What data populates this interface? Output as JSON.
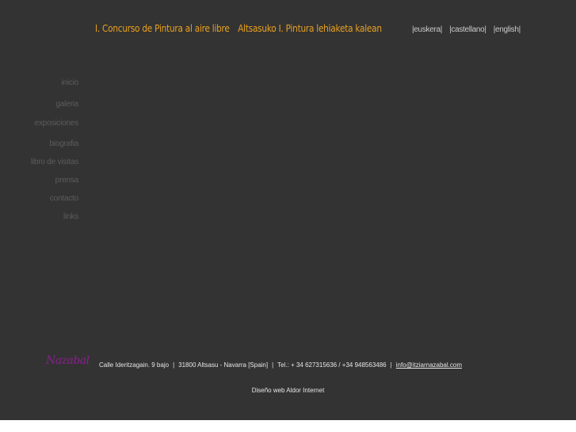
{
  "header": {
    "title_es": "I. Concurso de Pintura al aire libre",
    "title_eu": "Altsasuko I. Pintura lehiaketa kalean",
    "languages": [
      "|euskera|",
      "|castellano|",
      "|english|"
    ]
  },
  "nav": {
    "items": [
      "inicio",
      "galeria",
      "exposiciones",
      "biografia",
      "libro de visitas",
      "prensa",
      "contacto",
      "links"
    ]
  },
  "footer": {
    "signature": "Nazabal",
    "address": "Calle Ideritzagain. 9 bajo",
    "city": "31800 Altsasu - Navarra [Spain]",
    "phone": "Tel.: + 34 627315636 / +34 948563486",
    "separator": "|",
    "email": "info@itziarnazabal.com",
    "credit": "Diseño web Aldor Internet"
  }
}
